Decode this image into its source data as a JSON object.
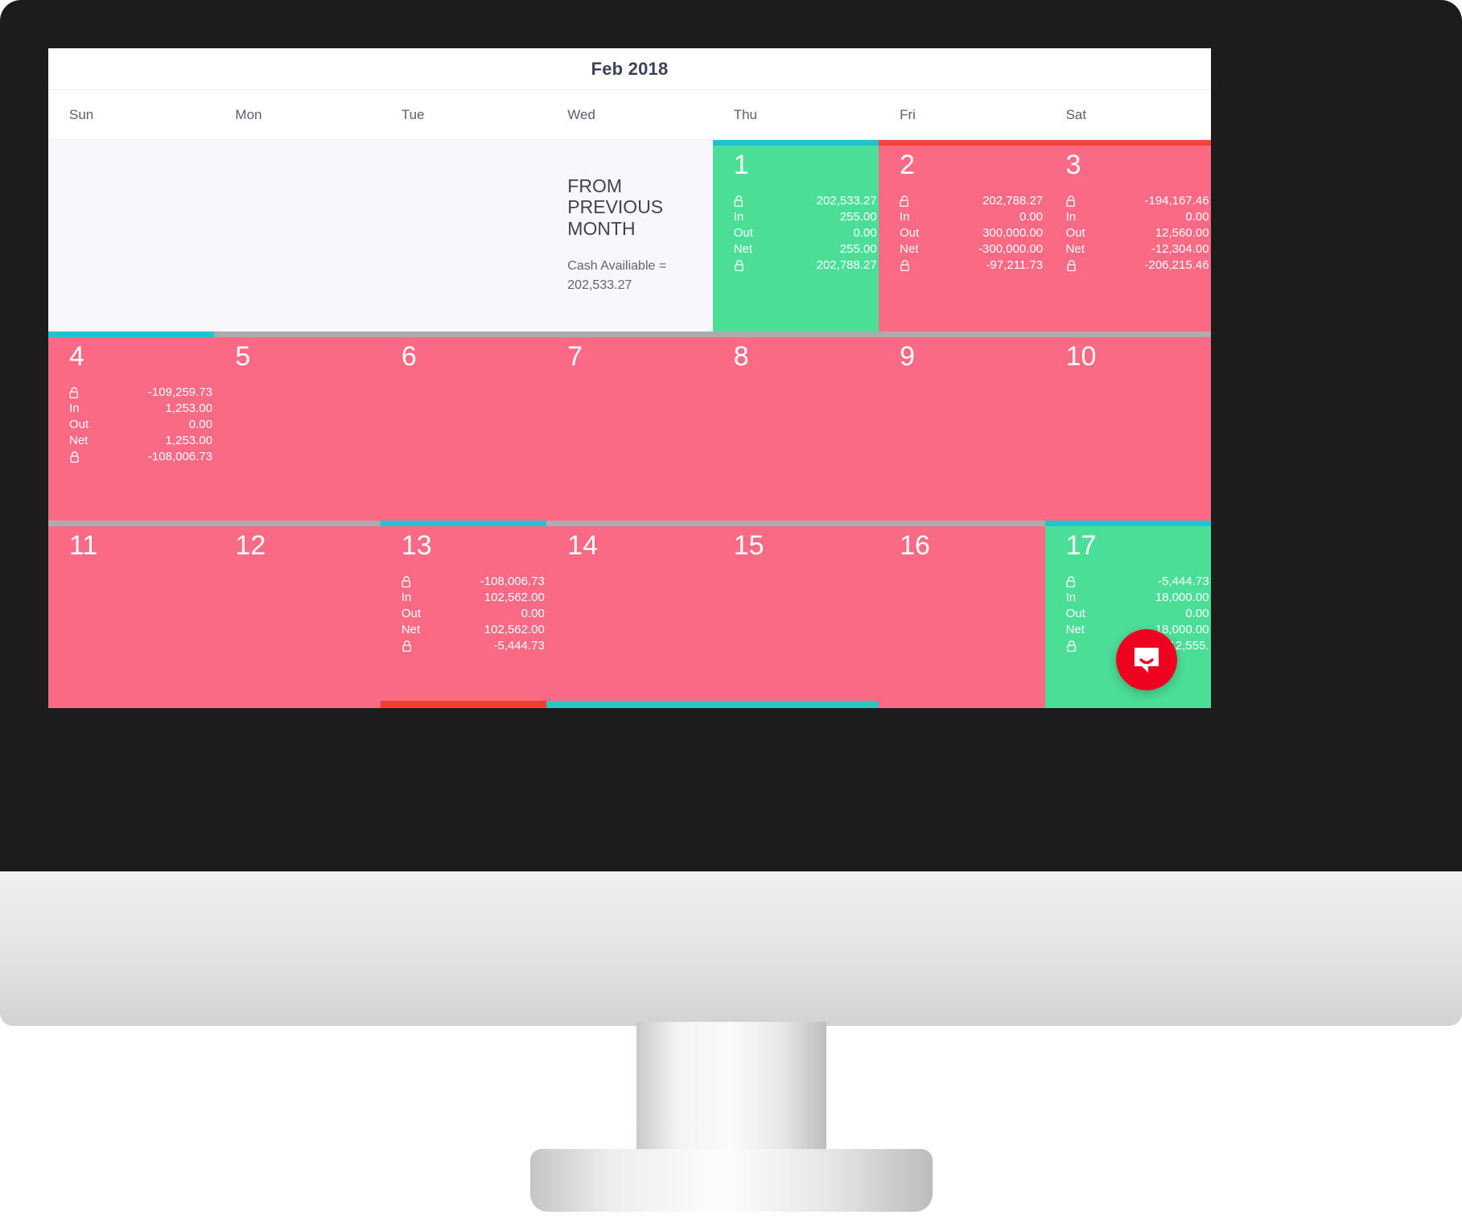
{
  "calendar": {
    "title": "Feb 2018",
    "weekdays": [
      "Sun",
      "Mon",
      "Tue",
      "Wed",
      "Thu",
      "Fri",
      "Sat"
    ],
    "labels": {
      "in": "In",
      "out": "Out",
      "net": "Net"
    },
    "prev_month": {
      "title": "FROM PREVIOUS MONTH",
      "subtitle": "Cash Availiable = 202,533.27"
    },
    "weeks": [
      {
        "days": [
          {
            "num": "",
            "state": "empty",
            "accent": "none",
            "bottom": "none",
            "figures": null
          },
          {
            "num": "",
            "state": "empty",
            "accent": "none",
            "bottom": "none",
            "figures": null
          },
          {
            "num": "",
            "state": "empty",
            "accent": "none",
            "bottom": "none",
            "figures": null
          },
          {
            "num": "",
            "state": "neutral",
            "accent": "none",
            "bottom": "none",
            "figures": null
          },
          {
            "num": "1",
            "state": "positive",
            "accent": "teal",
            "bottom": "none",
            "figures": {
              "open": "202,533.27",
              "in": "255.00",
              "out": "0.00",
              "net": "255.00",
              "close": "202,788.27"
            }
          },
          {
            "num": "2",
            "state": "negative",
            "accent": "red",
            "bottom": "none",
            "figures": {
              "open": "202,788.27",
              "in": "0.00",
              "out": "300,000.00",
              "net": "-300,000.00",
              "close": "-97,211.73"
            }
          },
          {
            "num": "3",
            "state": "negative",
            "accent": "red",
            "bottom": "none",
            "figures": {
              "open": "-194,167.46",
              "in": "0.00",
              "out": "12,560.00",
              "net": "-12,304.00",
              "close": "-206,215.46"
            }
          }
        ]
      },
      {
        "days": [
          {
            "num": "4",
            "state": "negative",
            "accent": "teal",
            "bottom": "none",
            "figures": {
              "open": "-109,259.73",
              "in": "1,253.00",
              "out": "0.00",
              "net": "1,253.00",
              "close": "-108,006.73"
            }
          },
          {
            "num": "5",
            "state": "negative",
            "accent": "gray",
            "bottom": "none",
            "figures": null
          },
          {
            "num": "6",
            "state": "negative",
            "accent": "gray",
            "bottom": "none",
            "figures": null
          },
          {
            "num": "7",
            "state": "negative",
            "accent": "gray",
            "bottom": "none",
            "figures": null
          },
          {
            "num": "8",
            "state": "negative",
            "accent": "gray",
            "bottom": "none",
            "figures": null
          },
          {
            "num": "9",
            "state": "negative",
            "accent": "gray",
            "bottom": "none",
            "figures": null
          },
          {
            "num": "10",
            "state": "negative",
            "accent": "gray",
            "bottom": "none",
            "figures": null
          }
        ]
      },
      {
        "days": [
          {
            "num": "11",
            "state": "negative",
            "accent": "gray",
            "bottom": "none",
            "figures": null
          },
          {
            "num": "12",
            "state": "negative",
            "accent": "gray",
            "bottom": "none",
            "figures": null
          },
          {
            "num": "13",
            "state": "negative",
            "accent": "teal",
            "bottom": "red",
            "figures": {
              "open": "-108,006.73",
              "in": "102,562.00",
              "out": "0.00",
              "net": "102,562.00",
              "close": "-5,444.73"
            }
          },
          {
            "num": "14",
            "state": "negative",
            "accent": "gray",
            "bottom": "teal",
            "figures": null
          },
          {
            "num": "15",
            "state": "negative",
            "accent": "gray",
            "bottom": "teal",
            "figures": null
          },
          {
            "num": "16",
            "state": "negative",
            "accent": "gray",
            "bottom": "none",
            "figures": null
          },
          {
            "num": "17",
            "state": "positive",
            "accent": "teal",
            "bottom": "none",
            "figures": {
              "open": "-5,444.73",
              "in": "18,000.00",
              "out": "0.00",
              "net": "18,000.00",
              "close": "12,555."
            }
          }
        ]
      }
    ]
  },
  "chat": {
    "label": "Open messenger"
  },
  "colors": {
    "positive": "#4ade97",
    "negative": "#fa6a85",
    "accent_teal": "#1ec4d0",
    "accent_red": "#f8403f",
    "accent_gray": "#acacac",
    "chat_bg": "#ee0220"
  }
}
